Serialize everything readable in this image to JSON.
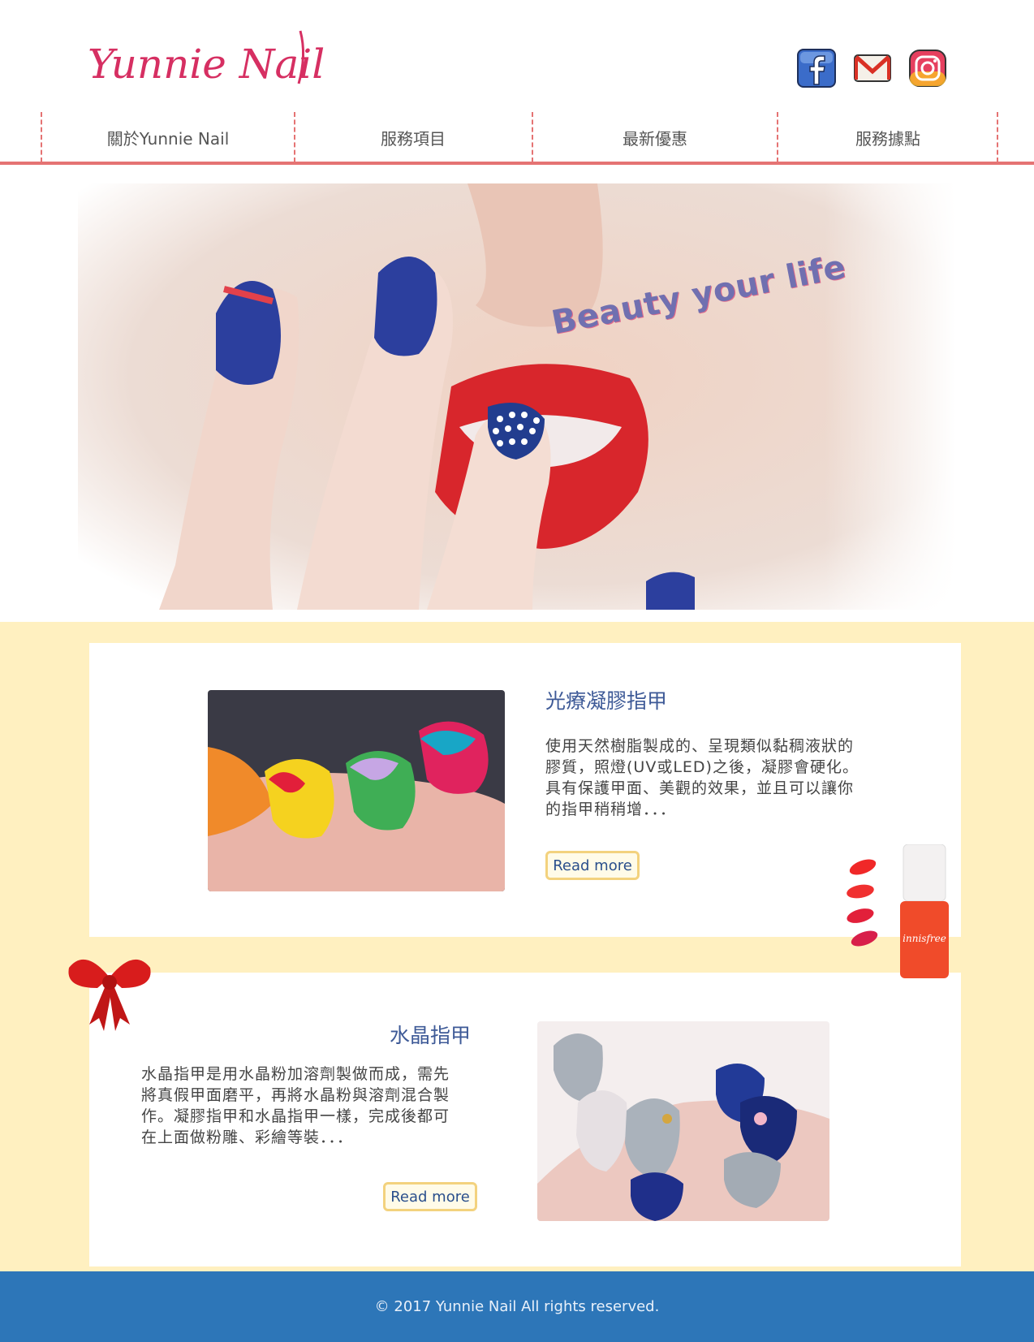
{
  "header": {
    "logo_text": "Yunnie Nail",
    "social": [
      {
        "name": "facebook-icon"
      },
      {
        "name": "gmail-icon"
      },
      {
        "name": "instagram-icon"
      }
    ]
  },
  "nav": {
    "items": [
      {
        "label": "關於Yunnie Nail"
      },
      {
        "label": "服務項目"
      },
      {
        "label": "最新優惠"
      },
      {
        "label": "服務據點"
      }
    ]
  },
  "hero": {
    "tagline": "Beauty your life"
  },
  "services": [
    {
      "title": "光療凝膠指甲",
      "description_lines": [
        "使用天然樹脂製成的、呈現類似黏稠液狀的",
        "膠質，照燈(UV或LED)之後，凝膠會硬化。",
        "具有保護甲面、美觀的效果，並且可以讓你",
        "的指甲稍稍增．．．"
      ],
      "button_label": "Read more"
    },
    {
      "title": "水晶指甲",
      "description_lines": [
        "水晶指甲是用水晶粉加溶劑製做而成，需先",
        "將真假甲面磨平，再將水晶粉與溶劑混合製",
        "作。凝膠指甲和水晶指甲一樣，完成後都可",
        "在上面做粉雕、彩繪等裝．．．"
      ],
      "button_label": "Read more"
    }
  ],
  "footer": {
    "copyright": "© 2017 Yunnie Nail All rights reserved."
  },
  "colors": {
    "accent_red": "#e57373",
    "section_bg": "#fff0c0",
    "footer_bg": "#2d76b8",
    "title_blue": "#3e5a97"
  }
}
